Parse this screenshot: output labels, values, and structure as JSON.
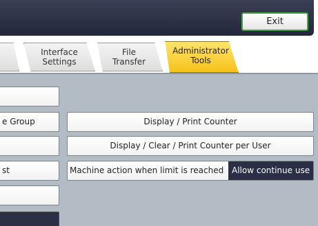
{
  "header": {
    "exit_label": "Exit"
  },
  "tabs": [
    {
      "line1": "",
      "line2": ""
    },
    {
      "line1": "Interface",
      "line2": "Settings"
    },
    {
      "line1": "File",
      "line2": "Transfer"
    },
    {
      "line1": "Administrator",
      "line2": "Tools"
    }
  ],
  "left_buttons": [
    "",
    "e Group",
    "",
    "st",
    ""
  ],
  "main_buttons": {
    "display_print_counter": "Display / Print Counter",
    "display_clear_print_counter_per_user": "Display / Clear / Print Counter per User"
  },
  "machine_action": {
    "label": "Machine action when limit is reached",
    "value": "Allow continue use"
  },
  "colors": {
    "active_tab": "#f6c21b",
    "panel_bg": "#b3bcc4",
    "exit_border": "#4aa34a",
    "selected_value_bg": "#2a2f45"
  }
}
